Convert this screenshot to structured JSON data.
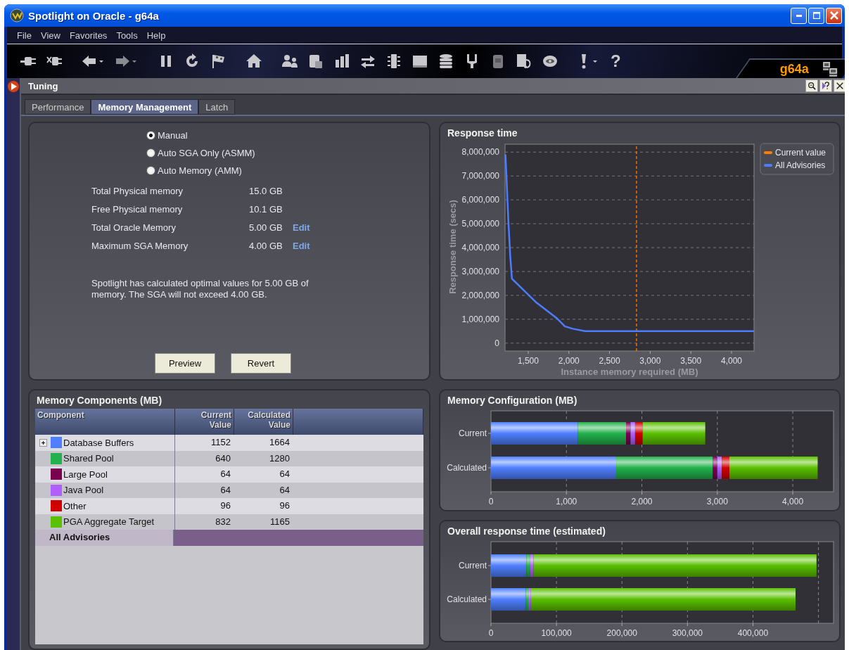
{
  "window": {
    "title": "Spotlight on Oracle - g64a"
  },
  "menu": [
    "File",
    "View",
    "Favorites",
    "Tools",
    "Help"
  ],
  "toolbar": {
    "help_glyph": "?",
    "connection": "g64a"
  },
  "panel": {
    "title": "Tuning"
  },
  "tabs": [
    {
      "label": "Performance",
      "selected": false
    },
    {
      "label": "Memory Management",
      "selected": true
    },
    {
      "label": "Latch",
      "selected": false
    }
  ],
  "modes": [
    {
      "label": "Manual",
      "selected": true
    },
    {
      "label": "Auto SGA Only (ASMM)",
      "selected": false
    },
    {
      "label": "Auto Memory (AMM)",
      "selected": false
    }
  ],
  "memory_info": [
    {
      "label": "Total Physical memory",
      "value": "15.0 GB"
    },
    {
      "label": "Free Physical memory",
      "value": "10.1 GB"
    },
    {
      "label": "Total Oracle Memory",
      "value": "5.00 GB",
      "link": "Edit"
    },
    {
      "label": "Maximum SGA Memory",
      "value": "4.00 GB",
      "link": "Edit"
    }
  ],
  "message": "Spotlight has calculated optimal values for 5.00 GB of memory. The SGA will not exceed 4.00 GB.",
  "buttons": [
    "Preview",
    "Revert"
  ],
  "components": {
    "title": "Memory Components (MB)",
    "columns": [
      "Component",
      "Current Value",
      "Calculated Value"
    ],
    "rows": [
      {
        "name": "Database Buffers",
        "color": "#4f7fff",
        "current": "1152",
        "calculated": "1664",
        "expandable": true
      },
      {
        "name": "Shared Pool",
        "color": "#22b14c",
        "current": "640",
        "calculated": "1280",
        "expandable": false
      },
      {
        "name": "Large Pool",
        "color": "#7a0050",
        "current": "64",
        "calculated": "64",
        "expandable": false
      },
      {
        "name": "Java Pool",
        "color": "#b060ff",
        "current": "64",
        "calculated": "64",
        "expandable": false
      },
      {
        "name": "Other",
        "color": "#d00000",
        "current": "96",
        "calculated": "96",
        "expandable": false
      },
      {
        "name": "PGA Aggregate Target",
        "color": "#5ac000",
        "current": "832",
        "calculated": "1165",
        "expandable": false
      }
    ],
    "total_row": "All Advisories"
  },
  "response_time": {
    "chart_data": {
      "type": "line",
      "title": "Response time",
      "grid": true,
      "legend": true,
      "xlabel": "Instance memory required (MB)",
      "ylabel": "Response time (secs)",
      "xlim": [
        1215,
        4277
      ],
      "ylim": [
        -330000,
        8330000
      ],
      "xticks": [
        {
          "value": 1500,
          "label": "1,500"
        },
        {
          "value": 2000,
          "label": "2,000"
        },
        {
          "value": 2500,
          "label": "2,500"
        },
        {
          "value": 3000,
          "label": "3,000"
        },
        {
          "value": 3500,
          "label": "3,500"
        },
        {
          "value": 4000,
          "label": "4,000"
        }
      ],
      "yticks": [
        {
          "value": 0,
          "label": "0"
        },
        {
          "value": 1000000,
          "label": "1,000,000"
        },
        {
          "value": 2000000,
          "label": "2,000,000"
        },
        {
          "value": 3000000,
          "label": "3,000,000"
        },
        {
          "value": 4000000,
          "label": "4,000,000"
        },
        {
          "value": 5000000,
          "label": "5,000,000"
        },
        {
          "value": 6000000,
          "label": "6,000,000"
        },
        {
          "value": 7000000,
          "label": "7,000,000"
        },
        {
          "value": 8000000,
          "label": "8,000,000"
        }
      ],
      "series": [
        {
          "name": "Current value",
          "color": "#ff7f00",
          "line_style": "dashed",
          "x": [
            2832,
            2832
          ],
          "values": [
            -330000,
            8330000
          ]
        },
        {
          "name": "All Advisories",
          "color": "#4d7cff",
          "line_style": "solid",
          "x": [
            1220,
            1235,
            1255,
            1280,
            1300,
            1600,
            1850,
            1950,
            2050,
            2200,
            4277
          ],
          "values": [
            7900000,
            6800000,
            5200000,
            3600000,
            2700000,
            1700000,
            1050000,
            700000,
            600000,
            500000,
            500000
          ]
        }
      ]
    }
  },
  "memory_configuration": {
    "chart_data": {
      "type": "bar",
      "orientation": "horizontal",
      "stacked": true,
      "grid": true,
      "title": "Memory Configuration (MB)",
      "categories": [
        "Current",
        "Calculated"
      ],
      "xlim": [
        0,
        4540
      ],
      "xticks": [
        {
          "value": 0,
          "label": "0"
        },
        {
          "value": 1000,
          "label": "1,000"
        },
        {
          "value": 2000,
          "label": "2,000"
        },
        {
          "value": 3000,
          "label": "3,000"
        },
        {
          "value": 4000,
          "label": "4,000"
        }
      ],
      "series": [
        {
          "color": "#4f7fff",
          "values": [
            1150,
            1660
          ]
        },
        {
          "color": "#22b14c",
          "values": [
            640,
            1280
          ]
        },
        {
          "color": "#7a0050",
          "values": [
            60,
            60
          ]
        },
        {
          "color": "#b060ff",
          "values": [
            60,
            60
          ]
        },
        {
          "color": "#d00000",
          "values": [
            100,
            100
          ]
        },
        {
          "color": "#5ac000",
          "values": [
            830,
            1170
          ]
        }
      ]
    }
  },
  "overall_response": {
    "chart_data": {
      "type": "bar",
      "orientation": "horizontal",
      "stacked": true,
      "grid": true,
      "title": "Overall response time (estimated)",
      "categories": [
        "Current",
        "Calculated"
      ],
      "xlim": [
        0,
        523000
      ],
      "xticks": [
        {
          "value": 0,
          "label": "0"
        },
        {
          "value": 100000,
          "label": "100,000"
        },
        {
          "value": 200000,
          "label": "200,000"
        },
        {
          "value": 300000,
          "label": "300,000"
        },
        {
          "value": 400000,
          "label": "400,000"
        }
      ],
      "series": [
        {
          "color": "#4f7fff",
          "values": [
            54000,
            53000
          ]
        },
        {
          "color": "#22b14c",
          "values": [
            6000,
            4000
          ]
        },
        {
          "color": "#b060ff",
          "values": [
            5000,
            4000
          ]
        },
        {
          "color": "#5ac000",
          "values": [
            432000,
            404000
          ]
        }
      ]
    }
  }
}
